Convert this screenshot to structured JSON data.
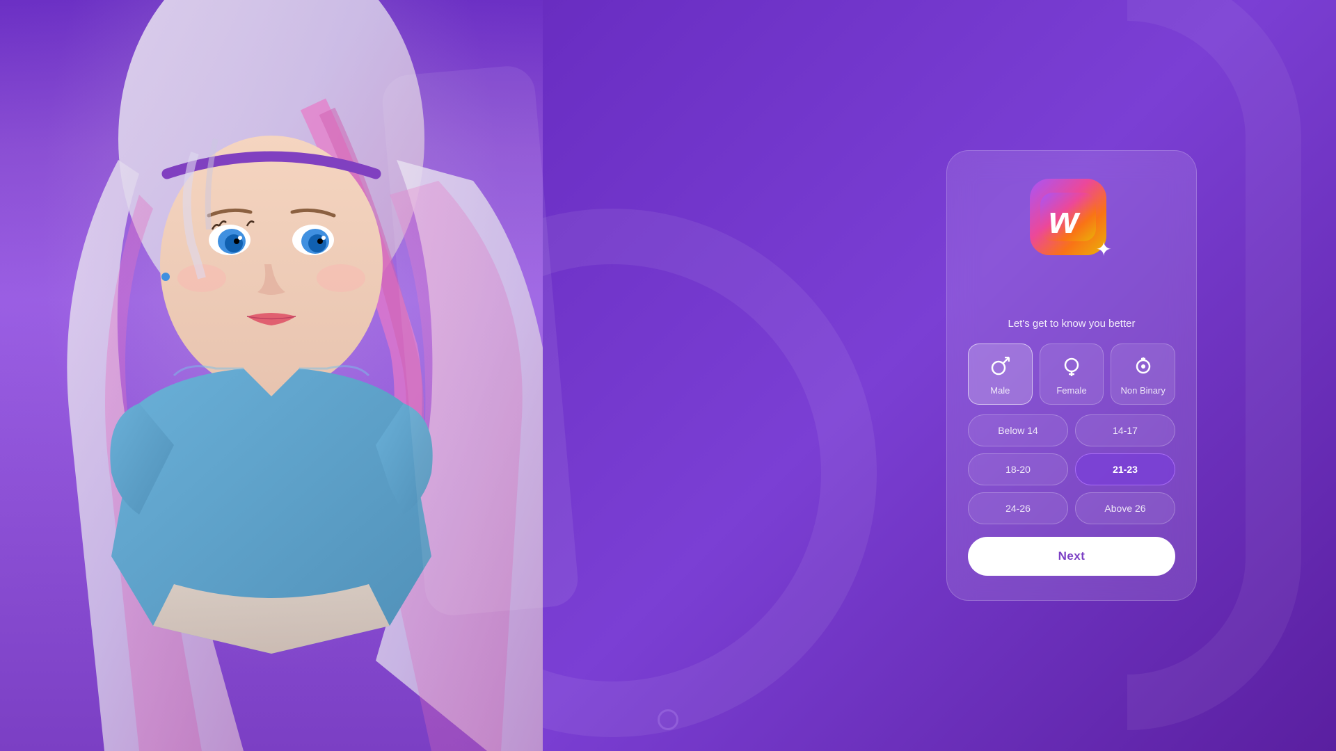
{
  "app": {
    "logo_letter": "W",
    "logo_sparkle": "✦"
  },
  "card": {
    "subtitle": "Let's get to know you better"
  },
  "gender": {
    "options": [
      {
        "id": "male",
        "label": "Male",
        "icon": "⚲",
        "selected": true
      },
      {
        "id": "female",
        "label": "Female",
        "icon": "⚬",
        "selected": false
      },
      {
        "id": "nonbinary",
        "label": "Non Binary",
        "icon": "◎",
        "selected": false
      }
    ]
  },
  "age": {
    "options": [
      {
        "id": "below14",
        "label": "Below 14",
        "selected": false
      },
      {
        "id": "14-17",
        "label": "14-17",
        "selected": false
      },
      {
        "id": "18-20",
        "label": "18-20",
        "selected": false
      },
      {
        "id": "21-23",
        "label": "21-23",
        "selected": true
      },
      {
        "id": "24-26",
        "label": "24-26",
        "selected": false
      },
      {
        "id": "above26",
        "label": "Above 26",
        "selected": false
      }
    ]
  },
  "next_button": {
    "label": "Next"
  }
}
